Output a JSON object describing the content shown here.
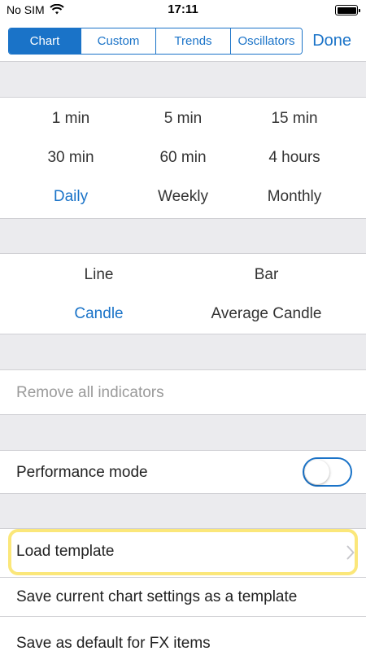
{
  "status_bar": {
    "carrier": "No SIM",
    "time": "17:11",
    "wifi_icon": "wifi-icon",
    "battery_icon": "battery-icon"
  },
  "tabs": [
    {
      "label": "Chart",
      "active": true
    },
    {
      "label": "Custom",
      "active": false
    },
    {
      "label": "Trends",
      "active": false
    },
    {
      "label": "Oscillators",
      "active": false
    }
  ],
  "done_label": "Done",
  "timeframes": [
    {
      "label": "1 min",
      "active": false
    },
    {
      "label": "5 min",
      "active": false
    },
    {
      "label": "15 min",
      "active": false
    },
    {
      "label": "30 min",
      "active": false
    },
    {
      "label": "60 min",
      "active": false
    },
    {
      "label": "4 hours",
      "active": false
    },
    {
      "label": "Daily",
      "active": true
    },
    {
      "label": "Weekly",
      "active": false
    },
    {
      "label": "Monthly",
      "active": false
    }
  ],
  "chart_types": [
    {
      "label": "Line",
      "active": false
    },
    {
      "label": "Bar",
      "active": false
    },
    {
      "label": "Candle",
      "active": true
    },
    {
      "label": "Average Candle",
      "active": false
    }
  ],
  "remove_indicators_label": "Remove all indicators",
  "performance_mode": {
    "label": "Performance mode",
    "enabled": false
  },
  "load_template_label": "Load template",
  "save_template_label": "Save current chart settings as a template",
  "save_default_label": "Save as default for FX items",
  "colors": {
    "accent": "#1a73c8",
    "highlight": "#fbe77a",
    "section_gap": "#ebebee",
    "disabled_text": "#9a9a9a"
  }
}
